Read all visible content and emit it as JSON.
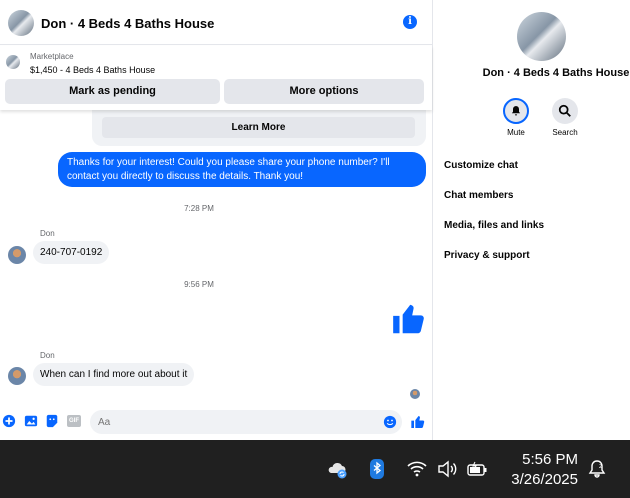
{
  "header": {
    "title": "Don · 4 Beds 4 Baths House"
  },
  "marketplace": {
    "label": "Marketplace",
    "item": "$1,450 - 4 Beds 4 Baths House",
    "pending_button": "Mark as pending",
    "more_button": "More options"
  },
  "messages": {
    "learn_more": "Learn More",
    "outgoing": "Thanks for your interest! Could you please share your phone number? I'll contact you directly to discuss the details. Thank you!",
    "time1": "7:28 PM",
    "sender1": "Don",
    "reply1": "240-707-0192",
    "time2": "9:56 PM",
    "sender2": "Don",
    "reply2": "When can I find more out about it"
  },
  "composer": {
    "placeholder": "Aa",
    "gif_label": "GIF"
  },
  "panel": {
    "name": "Don · 4 Beds 4 Baths House",
    "mute_label": "Mute",
    "search_label": "Search",
    "menu": [
      "Customize chat",
      "Chat members",
      "Media, files and links",
      "Privacy & support"
    ]
  },
  "taskbar": {
    "time": "5:56 PM",
    "date": "3/26/2025"
  },
  "colors": {
    "accent": "#0866ff",
    "taskbar": "#202020",
    "bubble_gray": "#f0f2f5"
  }
}
